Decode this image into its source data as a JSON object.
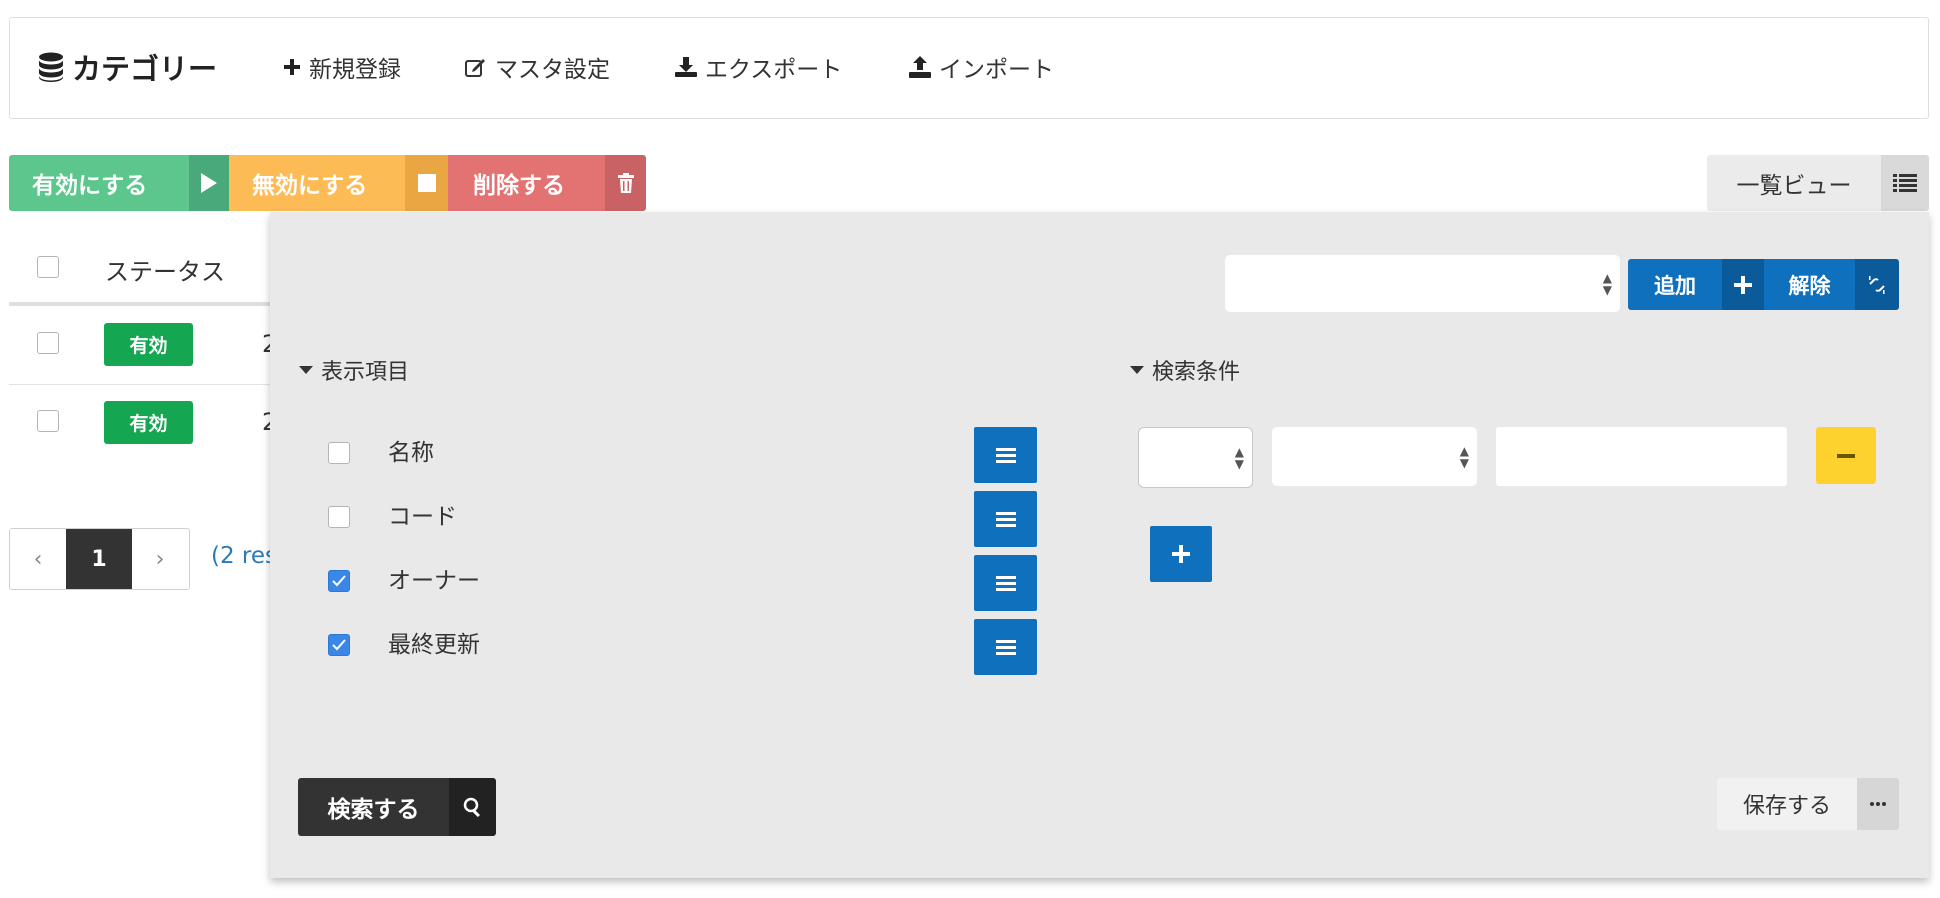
{
  "header": {
    "title": "カテゴリー",
    "title_icon": "database-icon",
    "nav": [
      {
        "label": "新規登録",
        "icon": "plus-icon"
      },
      {
        "label": "マスタ設定",
        "icon": "edit-icon"
      },
      {
        "label": "エクスポート",
        "icon": "download-icon"
      },
      {
        "label": "インポート",
        "icon": "upload-icon"
      }
    ]
  },
  "actions": {
    "enable_label": "有効にする",
    "disable_label": "無効にする",
    "delete_label": "削除する"
  },
  "view": {
    "label": "一覧ビュー"
  },
  "table": {
    "columns": [
      "ステータス"
    ],
    "rows": [
      {
        "status": "有効",
        "checked": false
      },
      {
        "status": "有効",
        "checked": false
      }
    ]
  },
  "pagination": {
    "prev": "‹",
    "current": "1",
    "next": "›",
    "results_text": "(2 res"
  },
  "panel": {
    "add_label": "追加",
    "clear_label": "解除",
    "display_section": "表示項目",
    "search_section": "検索条件",
    "display_items": [
      {
        "label": "名称",
        "checked": false
      },
      {
        "label": "コード",
        "checked": false
      },
      {
        "label": "オーナー",
        "checked": true
      },
      {
        "label": "最終更新",
        "checked": true
      }
    ],
    "search_label": "検索する",
    "save_label": "保存する"
  },
  "colors": {
    "enable": "#5cc68c",
    "disable": "#fdbb56",
    "delete": "#e37273",
    "primary": "#0f70bd",
    "badge": "#14a651",
    "warning": "#fdd22f"
  }
}
